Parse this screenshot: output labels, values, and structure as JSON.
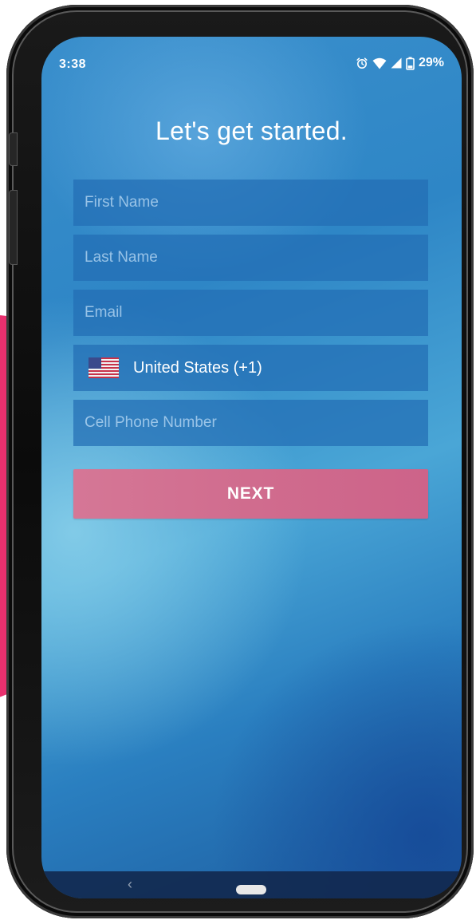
{
  "status_bar": {
    "time": "3:38",
    "battery": "29%",
    "icons": [
      "alarm-icon",
      "wifi-icon",
      "signal-icon",
      "battery-icon"
    ]
  },
  "signup": {
    "heading": "Let's get started.",
    "first_name_placeholder": "First Name",
    "last_name_placeholder": "Last Name",
    "email_placeholder": "Email",
    "country": "United States (+1)",
    "phone_placeholder": "Cell Phone Number",
    "next_label": "NEXT"
  },
  "nav_bar": {
    "back_glyph": "‹"
  },
  "colors": {
    "accent_pink": "#d06c8e",
    "field_bg": "#226eb4",
    "decor_pink": "#e8306e"
  }
}
